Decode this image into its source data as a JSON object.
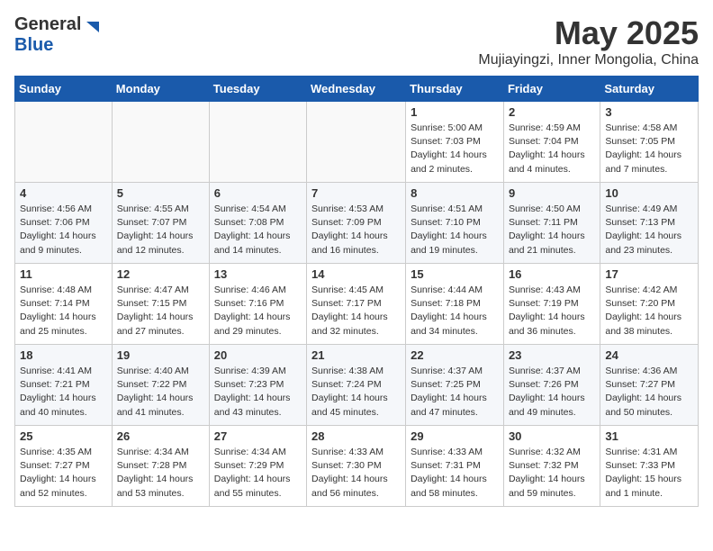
{
  "header": {
    "logo_general": "General",
    "logo_blue": "Blue",
    "title": "May 2025",
    "subtitle": "Mujiayingzi, Inner Mongolia, China"
  },
  "weekdays": [
    "Sunday",
    "Monday",
    "Tuesday",
    "Wednesday",
    "Thursday",
    "Friday",
    "Saturday"
  ],
  "weeks": [
    [
      {
        "day": "",
        "info": ""
      },
      {
        "day": "",
        "info": ""
      },
      {
        "day": "",
        "info": ""
      },
      {
        "day": "",
        "info": ""
      },
      {
        "day": "1",
        "info": "Sunrise: 5:00 AM\nSunset: 7:03 PM\nDaylight: 14 hours\nand 2 minutes."
      },
      {
        "day": "2",
        "info": "Sunrise: 4:59 AM\nSunset: 7:04 PM\nDaylight: 14 hours\nand 4 minutes."
      },
      {
        "day": "3",
        "info": "Sunrise: 4:58 AM\nSunset: 7:05 PM\nDaylight: 14 hours\nand 7 minutes."
      }
    ],
    [
      {
        "day": "4",
        "info": "Sunrise: 4:56 AM\nSunset: 7:06 PM\nDaylight: 14 hours\nand 9 minutes."
      },
      {
        "day": "5",
        "info": "Sunrise: 4:55 AM\nSunset: 7:07 PM\nDaylight: 14 hours\nand 12 minutes."
      },
      {
        "day": "6",
        "info": "Sunrise: 4:54 AM\nSunset: 7:08 PM\nDaylight: 14 hours\nand 14 minutes."
      },
      {
        "day": "7",
        "info": "Sunrise: 4:53 AM\nSunset: 7:09 PM\nDaylight: 14 hours\nand 16 minutes."
      },
      {
        "day": "8",
        "info": "Sunrise: 4:51 AM\nSunset: 7:10 PM\nDaylight: 14 hours\nand 19 minutes."
      },
      {
        "day": "9",
        "info": "Sunrise: 4:50 AM\nSunset: 7:11 PM\nDaylight: 14 hours\nand 21 minutes."
      },
      {
        "day": "10",
        "info": "Sunrise: 4:49 AM\nSunset: 7:13 PM\nDaylight: 14 hours\nand 23 minutes."
      }
    ],
    [
      {
        "day": "11",
        "info": "Sunrise: 4:48 AM\nSunset: 7:14 PM\nDaylight: 14 hours\nand 25 minutes."
      },
      {
        "day": "12",
        "info": "Sunrise: 4:47 AM\nSunset: 7:15 PM\nDaylight: 14 hours\nand 27 minutes."
      },
      {
        "day": "13",
        "info": "Sunrise: 4:46 AM\nSunset: 7:16 PM\nDaylight: 14 hours\nand 29 minutes."
      },
      {
        "day": "14",
        "info": "Sunrise: 4:45 AM\nSunset: 7:17 PM\nDaylight: 14 hours\nand 32 minutes."
      },
      {
        "day": "15",
        "info": "Sunrise: 4:44 AM\nSunset: 7:18 PM\nDaylight: 14 hours\nand 34 minutes."
      },
      {
        "day": "16",
        "info": "Sunrise: 4:43 AM\nSunset: 7:19 PM\nDaylight: 14 hours\nand 36 minutes."
      },
      {
        "day": "17",
        "info": "Sunrise: 4:42 AM\nSunset: 7:20 PM\nDaylight: 14 hours\nand 38 minutes."
      }
    ],
    [
      {
        "day": "18",
        "info": "Sunrise: 4:41 AM\nSunset: 7:21 PM\nDaylight: 14 hours\nand 40 minutes."
      },
      {
        "day": "19",
        "info": "Sunrise: 4:40 AM\nSunset: 7:22 PM\nDaylight: 14 hours\nand 41 minutes."
      },
      {
        "day": "20",
        "info": "Sunrise: 4:39 AM\nSunset: 7:23 PM\nDaylight: 14 hours\nand 43 minutes."
      },
      {
        "day": "21",
        "info": "Sunrise: 4:38 AM\nSunset: 7:24 PM\nDaylight: 14 hours\nand 45 minutes."
      },
      {
        "day": "22",
        "info": "Sunrise: 4:37 AM\nSunset: 7:25 PM\nDaylight: 14 hours\nand 47 minutes."
      },
      {
        "day": "23",
        "info": "Sunrise: 4:37 AM\nSunset: 7:26 PM\nDaylight: 14 hours\nand 49 minutes."
      },
      {
        "day": "24",
        "info": "Sunrise: 4:36 AM\nSunset: 7:27 PM\nDaylight: 14 hours\nand 50 minutes."
      }
    ],
    [
      {
        "day": "25",
        "info": "Sunrise: 4:35 AM\nSunset: 7:27 PM\nDaylight: 14 hours\nand 52 minutes."
      },
      {
        "day": "26",
        "info": "Sunrise: 4:34 AM\nSunset: 7:28 PM\nDaylight: 14 hours\nand 53 minutes."
      },
      {
        "day": "27",
        "info": "Sunrise: 4:34 AM\nSunset: 7:29 PM\nDaylight: 14 hours\nand 55 minutes."
      },
      {
        "day": "28",
        "info": "Sunrise: 4:33 AM\nSunset: 7:30 PM\nDaylight: 14 hours\nand 56 minutes."
      },
      {
        "day": "29",
        "info": "Sunrise: 4:33 AM\nSunset: 7:31 PM\nDaylight: 14 hours\nand 58 minutes."
      },
      {
        "day": "30",
        "info": "Sunrise: 4:32 AM\nSunset: 7:32 PM\nDaylight: 14 hours\nand 59 minutes."
      },
      {
        "day": "31",
        "info": "Sunrise: 4:31 AM\nSunset: 7:33 PM\nDaylight: 15 hours\nand 1 minute."
      }
    ]
  ]
}
